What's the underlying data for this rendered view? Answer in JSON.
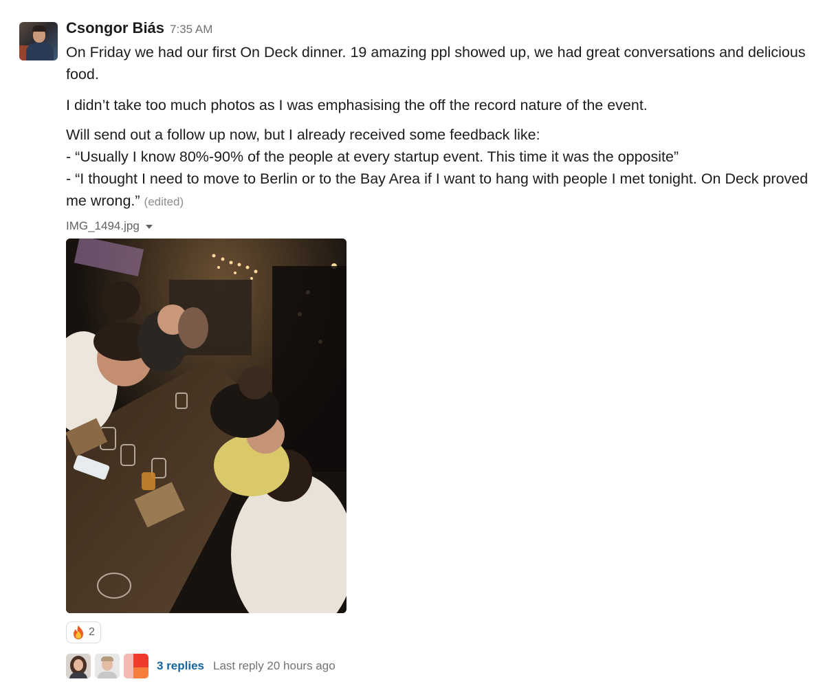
{
  "message": {
    "author": "Csongor Biás",
    "timestamp": "7:35 AM",
    "paragraphs": [
      "On Friday we had our first On Deck dinner. 19 amazing ppl showed up, we had great conversations and delicious food.",
      "I didn’t take too much photos as I was emphasising the off the record nature of the event."
    ],
    "feedback": {
      "intro": "Will send out a follow up now, but I already received some feedback like:",
      "quote1": "- “Usually I know 80%-90% of the people at every startup event. This time it was the opposite”",
      "quote2": "- “I thought I need to move to Berlin or to the Bay Area if I want to hang with people I met tonight. On Deck proved me wrong.”"
    },
    "edited_label": "(edited)"
  },
  "attachment": {
    "filename": "IMG_1494.jpg",
    "caret_icon": "caret-down-icon",
    "image_alt": "photo"
  },
  "reaction": {
    "emoji_icon": "fire-icon",
    "count": "2"
  },
  "thread": {
    "replies_label": "3 replies",
    "last_reply": "Last reply 20 hours ago"
  },
  "colors": {
    "link": "#1264a3",
    "muted": "#717274",
    "text": "#1d1c1d"
  }
}
